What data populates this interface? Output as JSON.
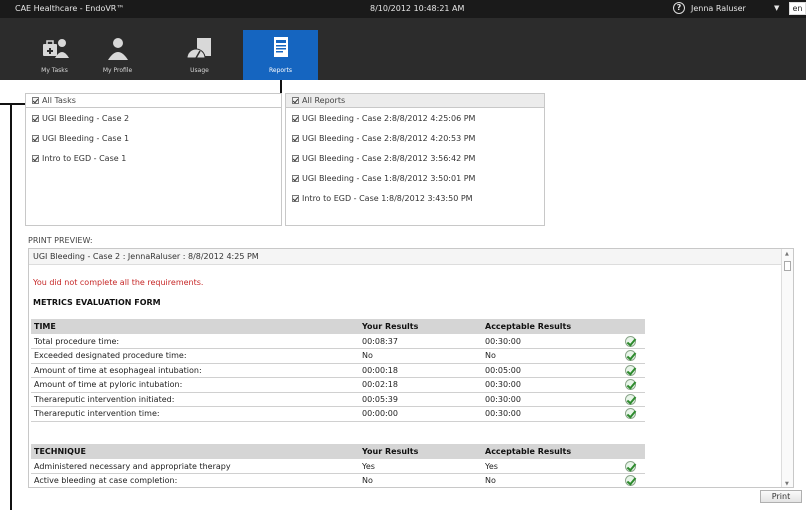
{
  "titlebar": {
    "app_title": "CAE Healthcare - EndoVR™",
    "datetime": "8/10/2012 10:48:21 AM",
    "help_symbol": "?",
    "user_name": "Jenna Raluser",
    "user_caret": "▼",
    "language": "en"
  },
  "nav": {
    "my_tasks": "My Tasks",
    "my_profile": "My Profile",
    "usage": "Usage",
    "reports": "Reports",
    "active_color": "#1565c0"
  },
  "tasks_panel": {
    "header": "All Tasks",
    "items": [
      "UGI Bleeding - Case 2",
      "UGI Bleeding - Case 1",
      "Intro to EGD - Case 1"
    ]
  },
  "reports_panel": {
    "header": "All Reports",
    "items": [
      "UGI Bleeding - Case 2:8/8/2012 4:25:06 PM",
      "UGI Bleeding - Case 2:8/8/2012 4:20:53 PM",
      "UGI Bleeding - Case 2:8/8/2012 3:56:42 PM",
      "UGI Bleeding - Case 1:8/8/2012 3:50:01 PM",
      "Intro to EGD - Case 1:8/8/2012 3:43:50 PM"
    ]
  },
  "preview": {
    "label": "PRINT PREVIEW:",
    "header": "UGI Bleeding - Case 2 : JennaRaluser : 8/8/2012 4:25 PM",
    "warning": "You did not complete all the requirements.",
    "form_title": "METRICS EVALUATION FORM",
    "warning_color": "#c62828",
    "time_section": {
      "title": "TIME",
      "col_your": "Your Results",
      "col_acceptable": "Acceptable Results",
      "rows": [
        [
          "Total procedure time:",
          "00:08:37",
          "00:30:00"
        ],
        [
          "Exceeded designated procedure time:",
          "No",
          "No"
        ],
        [
          "Amount of time at esophageal intubation:",
          "00:00:18",
          "00:05:00"
        ],
        [
          "Amount of time at pyloric intubation:",
          "00:02:18",
          "00:30:00"
        ],
        [
          "Therareputic intervention initiated:",
          "00:05:39",
          "00:30:00"
        ],
        [
          "Therareputic intervention time:",
          "00:00:00",
          "00:30:00"
        ]
      ]
    },
    "technique_section": {
      "title": "TECHNIQUE",
      "col_your": "Your Results",
      "col_acceptable": "Acceptable Results",
      "rows": [
        [
          "Administered necessary and appropriate therapy",
          "Yes",
          "Yes"
        ],
        [
          "Active bleeding at case completion:",
          "No",
          "No"
        ]
      ]
    }
  },
  "print_button": "Print"
}
